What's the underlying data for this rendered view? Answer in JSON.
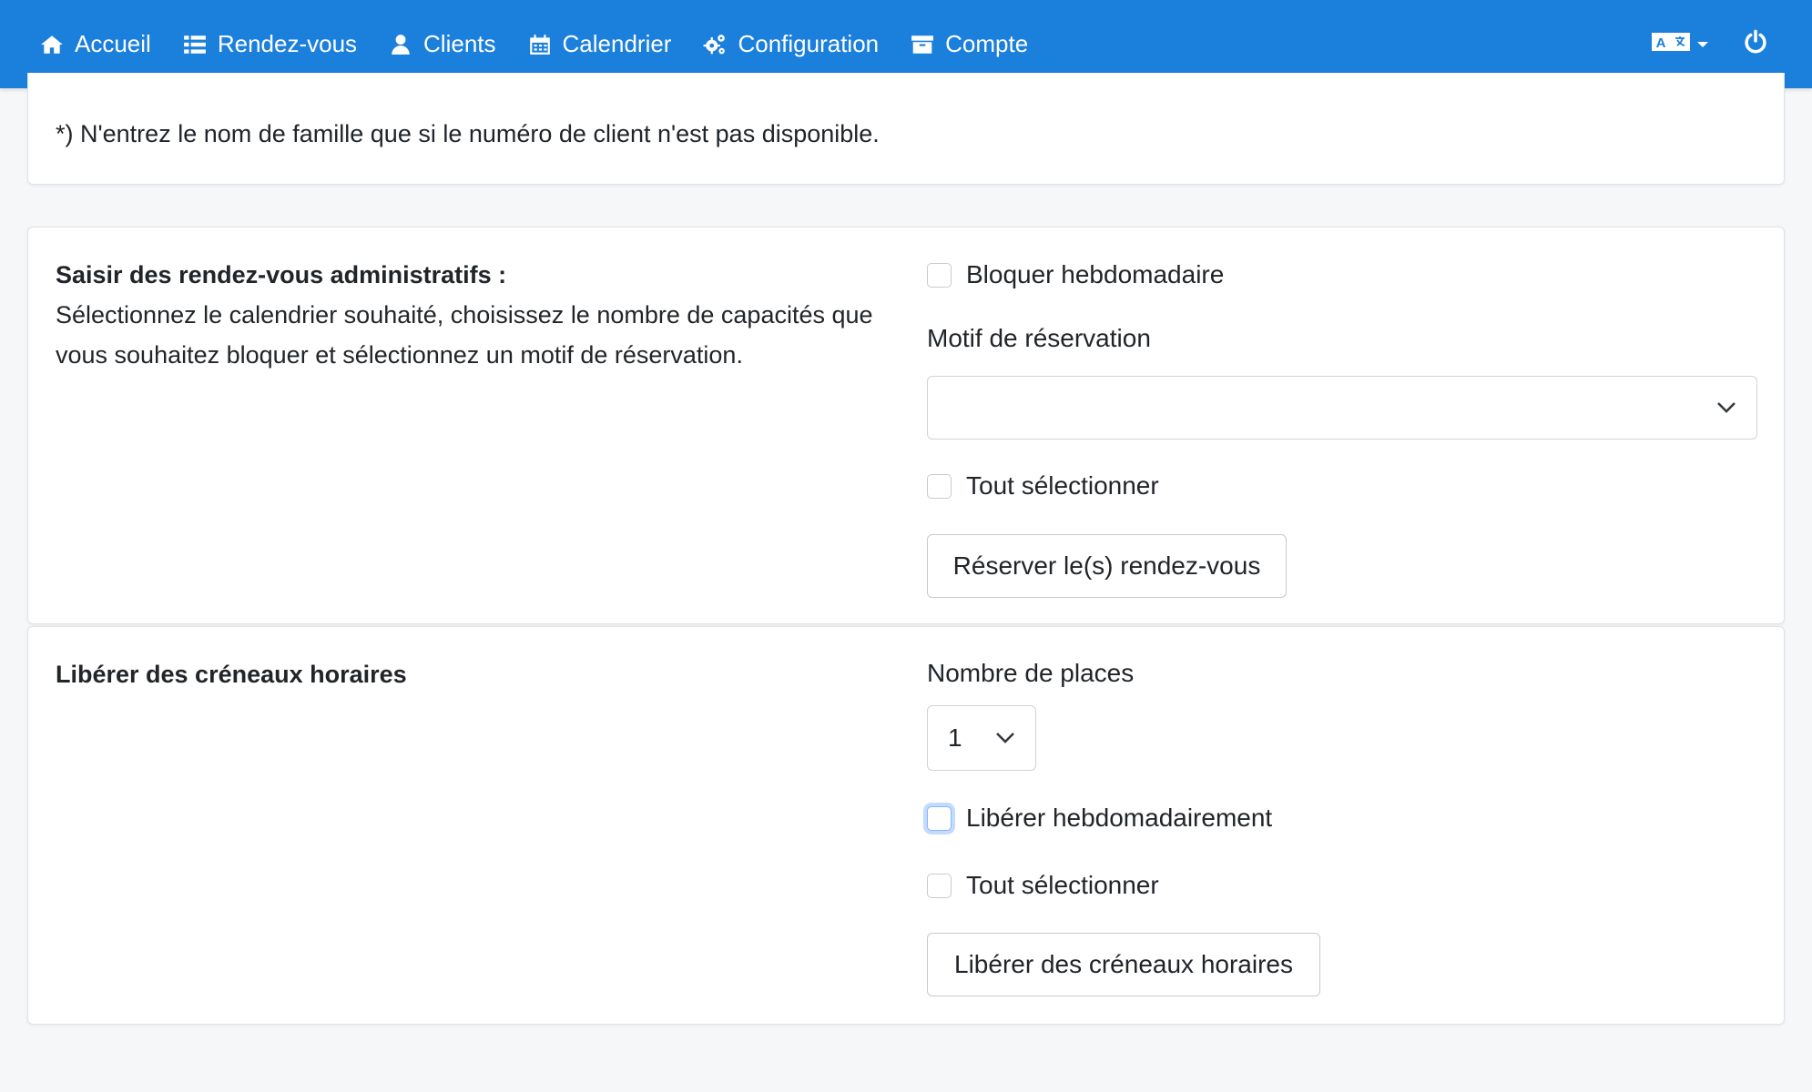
{
  "nav": {
    "items": [
      {
        "label": "Accueil",
        "icon": "home-icon"
      },
      {
        "label": "Rendez-vous",
        "icon": "list-icon"
      },
      {
        "label": "Clients",
        "icon": "user-icon"
      },
      {
        "label": "Calendrier",
        "icon": "calendar-icon"
      },
      {
        "label": "Configuration",
        "icon": "cogs-icon"
      },
      {
        "label": "Compte",
        "icon": "archive-icon"
      }
    ],
    "language_icon": "language-icon",
    "power_icon": "power-icon",
    "bar_color": "#1b7fdc"
  },
  "notice": {
    "text": "*) N'entrez le nom de famille que si le numéro de client n'est pas disponible."
  },
  "admin": {
    "title": "Saisir des rendez-vous administratifs :",
    "description": "Sélectionnez le calendrier souhaité, choisissez le nombre de capacités que vous souhaitez bloquer et sélectionnez un motif de réservation.",
    "block_weekly_label": "Bloquer hebdomadaire",
    "reason_label": "Motif de réservation",
    "reason_value": "",
    "select_all_label": "Tout sélectionner",
    "reserve_button": "Réserver le(s) rendez-vous"
  },
  "release": {
    "title": "Libérer des créneaux horaires",
    "places_label": "Nombre de places",
    "places_value": "1",
    "release_weekly_label": "Libérer hebdomadairement",
    "select_all_label": "Tout sélectionner",
    "release_button": "Libérer des créneaux horaires"
  }
}
